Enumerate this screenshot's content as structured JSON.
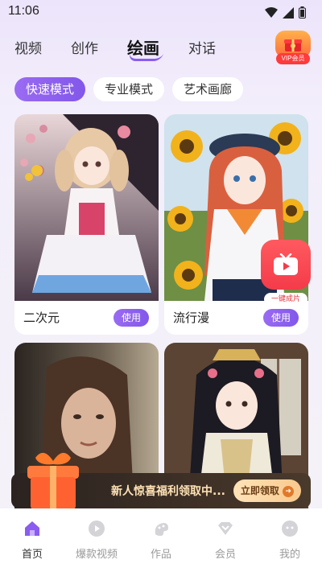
{
  "status": {
    "time": "11:06"
  },
  "topnav": {
    "tabs": [
      "视频",
      "创作",
      "绘画",
      "对话"
    ],
    "active": "绘画"
  },
  "vip": {
    "label": "VIP会员"
  },
  "modes": {
    "items": [
      "快速模式",
      "专业模式",
      "艺术画廊"
    ],
    "active": "快速模式"
  },
  "cards": [
    {
      "name": "二次元",
      "use_label": "使用"
    },
    {
      "name": "流行漫",
      "use_label": "使用"
    },
    {
      "name": "",
      "use_label": ""
    },
    {
      "name": "",
      "use_label": ""
    }
  ],
  "oneclick": {
    "label": "一键成片"
  },
  "promo": {
    "text": "新人惊喜福利领取中...",
    "cta": "立即领取"
  },
  "bottomnav": {
    "items": [
      {
        "label": "首页",
        "icon": "home-icon"
      },
      {
        "label": "爆款视频",
        "icon": "video-icon"
      },
      {
        "label": "作品",
        "icon": "works-icon"
      },
      {
        "label": "会员",
        "icon": "member-icon"
      },
      {
        "label": "我的",
        "icon": "profile-icon"
      }
    ],
    "active": "首页"
  },
  "colors": {
    "accent": "#8a5cf0",
    "promo_text": "#ffe2b5",
    "oneclick": "#f43b4a"
  }
}
